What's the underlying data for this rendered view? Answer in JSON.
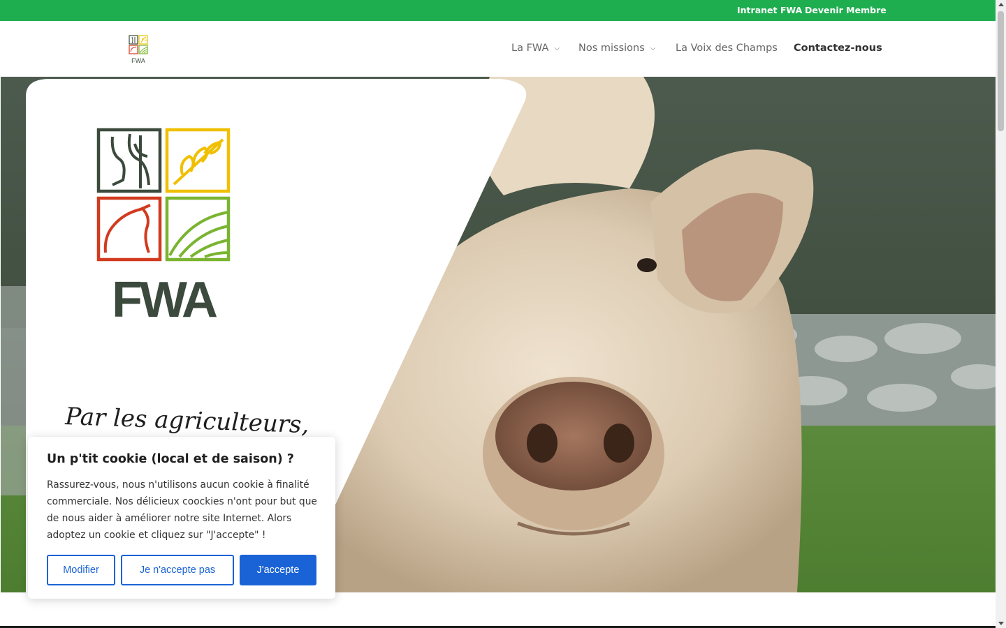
{
  "topbar": {
    "intranet_label": "Intranet FWA",
    "member_label": "Devenir Membre",
    "color": "#1fae4f"
  },
  "header": {
    "logo_text": "FWA",
    "nav": [
      {
        "label": "La FWA",
        "dropdown": true
      },
      {
        "label": "Nos missions",
        "dropdown": true
      },
      {
        "label": "La Voix des Champs",
        "dropdown": false
      },
      {
        "label": "Contactez-nous",
        "dropdown": false
      }
    ]
  },
  "hero": {
    "logo_text": "FWA",
    "tagline": "Par les agriculteurs,",
    "image": "cow-photo"
  },
  "cookie": {
    "title": "Un p'tit cookie (local et de saison) ?",
    "text": "Rassurez-vous, nous n'utilisons aucun cookie à finalité commerciale. Nos délicieux coockies n'ont pour but que de nous aider à améliorer notre site Internet. Alors adoptez un cookie et cliquez sur \"J'accepte\" !",
    "btn_modify": "Modifier",
    "btn_refuse": "Je n'accepte pas",
    "btn_accept": "J'accepte",
    "accent_color": "#1a63d6"
  },
  "icons": {
    "chevron": "chevron-down-icon",
    "logo": "fwa-logo-icon"
  }
}
